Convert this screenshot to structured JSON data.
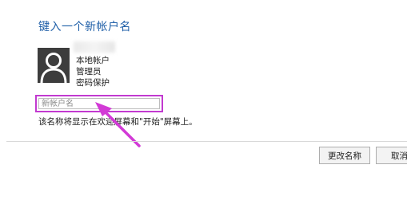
{
  "dialog": {
    "title": "键入一个新帐户名",
    "account": {
      "type": "本地帐户",
      "role": "管理员",
      "protection": "密码保护"
    },
    "name_field": {
      "placeholder": "新帐户名",
      "value": ""
    },
    "hint": "该名称将显示在欢迎屏幕和\"开始\"屏幕上。",
    "buttons": {
      "rename": "更改名称",
      "cancel": "取消"
    }
  },
  "colors": {
    "title": "#1f5fa8",
    "highlight": "#c23ad0",
    "avatar_bg": "#3d3d3d"
  },
  "icons": {
    "avatar": "user-silhouette-icon",
    "annotation": "pink-arrow-annotation"
  }
}
